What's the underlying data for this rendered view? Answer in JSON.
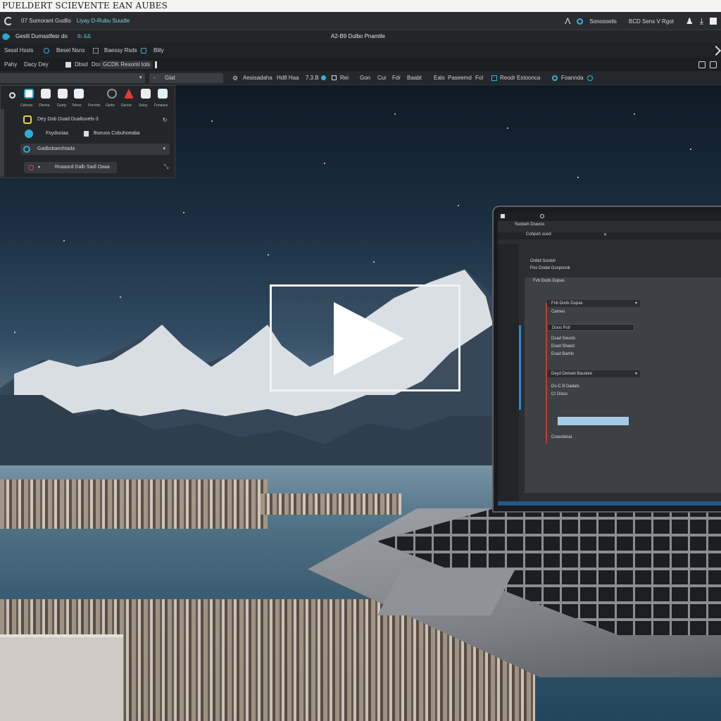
{
  "window": {
    "title": "PUELDERT SCIEVENTE EAN AUBES"
  },
  "menubar": {
    "items": [
      "07 Sumorant Gudlis",
      "Liyay D-Rubu Suudle"
    ],
    "right": {
      "label1": "Sonosseils",
      "label2": "BCD Sens V Rgot"
    }
  },
  "subbar": {
    "left": "Geslil Dumsstfesr do",
    "left_accent": "lb  &&",
    "center": "A2-B9 Dulbo Pnamtle"
  },
  "toolbar1": {
    "items": [
      "Sessl Hssls",
      "Besel Nsns",
      "Baessy Rsds",
      "Blily"
    ]
  },
  "toolbar2": {
    "items": [
      "Pahy",
      "Dacy Dey",
      "Dbsd",
      "Dosr",
      "GCDK Resoml tols"
    ]
  },
  "toolbar3": {
    "items": [
      "Glat",
      "Aesisadaha",
      "Hd8 Haa",
      "7.3.B",
      "Rei",
      "Gon",
      "Cur",
      "Fdr",
      "Baabt",
      "Eals",
      "Paseemd",
      "Fol",
      "Reodr Estoonca",
      "Foannda"
    ]
  },
  "panel": {
    "tools": [
      "Cehoos",
      "Dlevhe",
      "Goely",
      "Tohoe",
      "Fhcvhts",
      "Glohc",
      "Gevoe",
      "Seloy",
      "Fonasns"
    ],
    "rows": [
      {
        "label": "Dey Dob Duad Dualtuvels-3"
      },
      {
        "label": "Fsydsoiaa",
        "label2": "Bseuos Cobuhoeaba"
      },
      {
        "label": "Gadbsbaeshtada"
      },
      {
        "label": "Roaasrd Dalb Sadl Oaaa"
      }
    ]
  },
  "laptop": {
    "title": "Sudoeh Dseoss",
    "tab1": "Cohpeh sood",
    "tab2": "Onlitd Sordsh",
    "tab3": "Pos  Dodat Guspsnok",
    "dropdown1": {
      "label": "Fvb  Dods Dupas",
      "sub": "Cameo"
    },
    "input_value": "Doos Pstl",
    "list1": [
      "Dsad Seuols",
      "Esad Sbaed",
      "Esad Bamls"
    ],
    "dropdown2": {
      "label": "Deyd Deloeb Bauslee"
    },
    "list2": [
      "Ds-C B Dadals",
      "Cr Dlass"
    ],
    "footer": "Coaodatua"
  },
  "colors": {
    "accent_cyan": "#33b6d6",
    "accent_red": "#c63a30",
    "highlight_blue": "#a7cde6"
  }
}
